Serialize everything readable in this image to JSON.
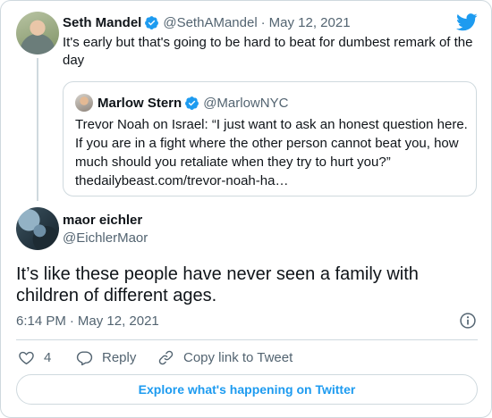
{
  "parent_tweet": {
    "author_name": "Seth Mandel",
    "handle": "@SethAMandel",
    "separator": "·",
    "date": "May 12, 2021",
    "text": "It's early but that's going to be hard to beat for dumbest remark of the day",
    "quote": {
      "author_name": "Marlow Stern",
      "handle": "@MarlowNYC",
      "text": "Trevor Noah on Israel: “I just want to ask an honest question here. If you are in a fight where the other person cannot beat you, how much should you retaliate when they try to hurt you?”",
      "link": "thedailybeast.com/trevor-noah-ha…"
    }
  },
  "main_tweet": {
    "author_name": "maor eichler",
    "handle": "@EichlerMaor",
    "text": "It’s like these people have never seen a family with children of different ages.",
    "time": "6:14 PM",
    "separator": "·",
    "date": "May 12, 2021"
  },
  "actions": {
    "like_count": "4",
    "reply_label": "Reply",
    "copy_link_label": "Copy link to Tweet"
  },
  "explore_label": "Explore what's happening on Twitter",
  "colors": {
    "brand_blue": "#1d9bf0",
    "text_primary": "#0f1419",
    "text_secondary": "#536471",
    "border": "#cfd9de"
  },
  "icons": [
    "twitter-bird-icon",
    "verified-badge-icon",
    "info-icon",
    "heart-icon",
    "reply-icon",
    "link-icon"
  ]
}
